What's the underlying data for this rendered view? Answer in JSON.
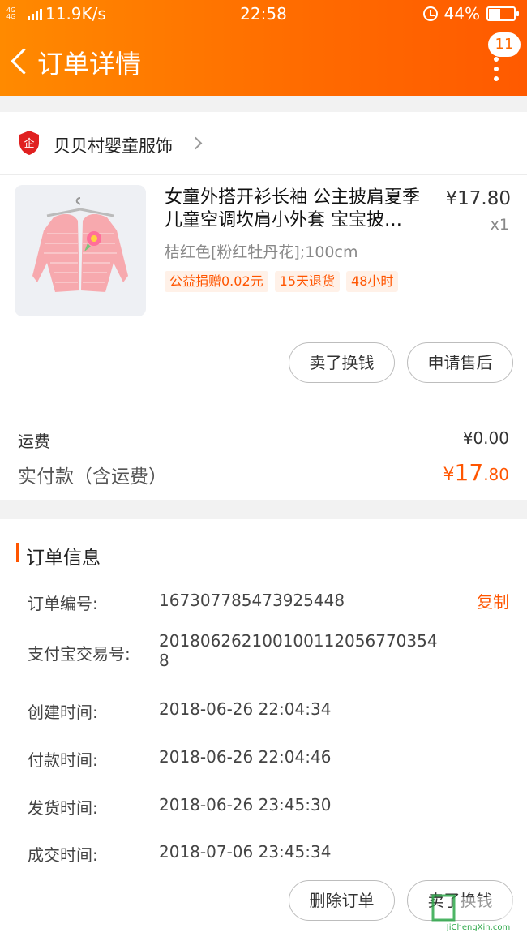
{
  "status_bar": {
    "network": "4G 4G",
    "speed": "11.9K/s",
    "time": "22:58",
    "battery": "44%",
    "battery_level": 0.44
  },
  "nav": {
    "title": "订单详情",
    "badge": "11"
  },
  "shop": {
    "name": "贝贝村婴童服饰",
    "logo_text": "企"
  },
  "product": {
    "title": "女童外搭开衫长袖 公主披肩夏季儿童空调坎肩小外套 宝宝披…",
    "price": "¥17.80",
    "qty": "x1",
    "spec": "桔红色[粉红牡丹花];100cm",
    "tags": [
      "公益捐赠0.02元",
      "15天退货",
      "48小时"
    ]
  },
  "actions": {
    "sell_label": "卖了换钱",
    "aftersale_label": "申请售后"
  },
  "summary": {
    "shipping_label": "运费",
    "shipping_value": "¥0.00",
    "paid_label": "实付款（含运费）",
    "paid_currency": "¥",
    "paid_int": "17",
    "paid_dec": ".80"
  },
  "order_info": {
    "title": "订单信息",
    "copy_label": "复制",
    "rows": [
      {
        "label": "订单编号:",
        "value": "167307785473925448"
      },
      {
        "label": "支付宝交易号:",
        "value": "2018062621001001120567703548"
      },
      {
        "label": "创建时间:",
        "value": "2018-06-26 22:04:34"
      },
      {
        "label": "付款时间:",
        "value": "2018-06-26 22:04:46"
      },
      {
        "label": "发货时间:",
        "value": "2018-06-26 23:45:30"
      },
      {
        "label": "成交时间:",
        "value": "2018-07-06 23:45:34"
      }
    ]
  },
  "bottom": {
    "delete_label": "删除订单",
    "sell_label": "卖了换钱"
  },
  "watermark": {
    "text": "JiChengXin.com"
  },
  "colors": {
    "accent": "#ff5500",
    "header_start": "#ff8a00",
    "header_end": "#ff5a00"
  }
}
